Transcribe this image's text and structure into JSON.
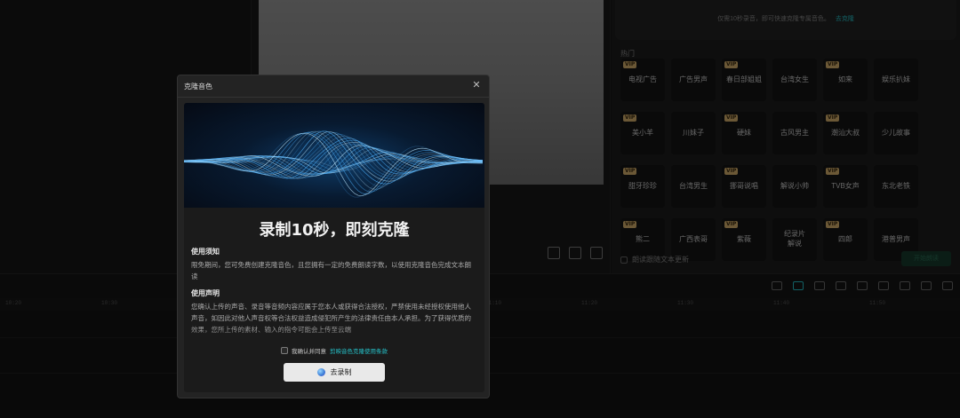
{
  "right_panel": {
    "tip_text": "仅需10秒录音，即可快速克隆专属音色。",
    "tip_link": "去克隆",
    "section_label": "热门",
    "voices": [
      {
        "label": "电视广告",
        "vip": true
      },
      {
        "label": "广告男声",
        "vip": false
      },
      {
        "label": "春日部姐姐",
        "vip": true
      },
      {
        "label": "台湾女生",
        "vip": false
      },
      {
        "label": "如来",
        "vip": true
      },
      {
        "label": "娱乐扒妹",
        "vip": false
      },
      {
        "label": "美小羊",
        "vip": true
      },
      {
        "label": "川妹子",
        "vip": false
      },
      {
        "label": "硬妹",
        "vip": true
      },
      {
        "label": "古风男主",
        "vip": false
      },
      {
        "label": "潮汕大叔",
        "vip": true
      },
      {
        "label": "少儿故事",
        "vip": false
      },
      {
        "label": "甜牙珍珍",
        "vip": true
      },
      {
        "label": "台湾男生",
        "vip": false
      },
      {
        "label": "挪哥说唱",
        "vip": true
      },
      {
        "label": "解说小帅",
        "vip": false
      },
      {
        "label": "TVB女声",
        "vip": true
      },
      {
        "label": "东北老铁",
        "vip": false
      },
      {
        "label": "熊二",
        "vip": true
      },
      {
        "label": "广西表哥",
        "vip": false
      },
      {
        "label": "紫薇",
        "vip": true
      },
      {
        "label": "纪录片\n解说",
        "vip": false
      },
      {
        "label": "四郎",
        "vip": true
      },
      {
        "label": "港普男声",
        "vip": false
      }
    ],
    "vip_badge": "VIP",
    "footer_checkbox_label": "朗读跟随文本更新",
    "apply_button": "开始朗读"
  },
  "timeline": {
    "ticks": [
      "10:20",
      "10:30",
      "10:40",
      "10:50",
      "11:00",
      "11:10",
      "11:20",
      "11:30",
      "11:40",
      "11:50",
      "12"
    ]
  },
  "modal": {
    "title": "克隆音色",
    "close_glyph": "✕",
    "headline": "录制10秒，即刻克隆",
    "usage_title": "使用须知",
    "usage_text": "限免期间，您可免费创建克隆音色，且您拥有一定的免费朗读字数，以使用克隆音色完成文本朗读",
    "statement_title": "使用声明",
    "statement_text": "您确认上传的声音、录音等音频内容应属于您本人或获得合法授权，严禁使用未经授权使用他人声音，如因此对他人声音权等合法权益造成侵犯所产生的法律责任由本人承担。为了获得优质的效果，您所上传的素材、输入的指令可能会上传至云端",
    "agree_text": "我确认并同意",
    "agree_link": "剪映音色克隆使用条款",
    "record_button": "去录制"
  },
  "colors": {
    "accent": "#25c0c8",
    "vip_gold": "#d7b06c"
  }
}
